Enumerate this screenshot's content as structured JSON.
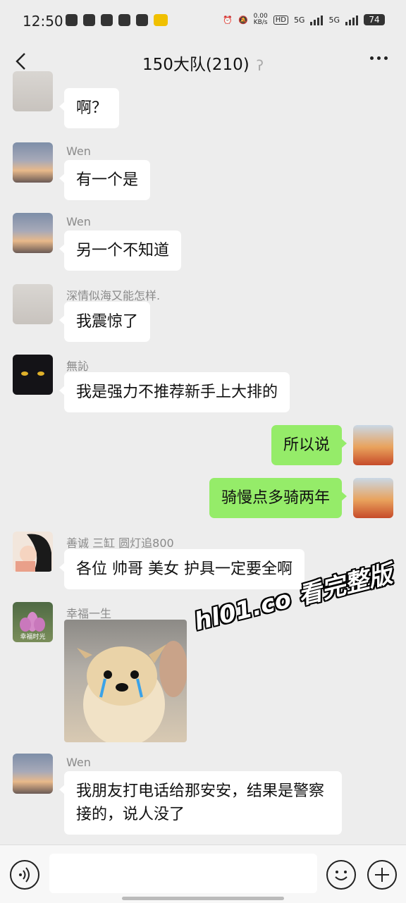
{
  "status_bar": {
    "time": "12:50",
    "net_speed_value": "0.00",
    "net_speed_unit": "KB/s",
    "hd_label": "HD",
    "signal1_label": "5G",
    "signal2_label": "5G",
    "battery": "74"
  },
  "header": {
    "title": "150大队(210)"
  },
  "messages": [
    {
      "sender": "",
      "text": "啊？"
    },
    {
      "sender": "Wen",
      "text": "有一个是"
    },
    {
      "sender": "Wen",
      "text": "另一个不知道"
    },
    {
      "sender": "深情似海又能怎样.",
      "text": "我震惊了"
    },
    {
      "sender": "無訫",
      "text": "我是强力不推荐新手上大排的"
    },
    {
      "sender": "me",
      "text": "所以说"
    },
    {
      "sender": "me",
      "text": "骑慢点多骑两年"
    },
    {
      "sender": "善诚 三缸 圆灯追800",
      "text": "各位 帅哥 美女 护具一定要全啊"
    },
    {
      "sender": "幸福一生",
      "image": "crying-puppy-sticker"
    },
    {
      "sender": "Wen",
      "text": "我朋友打电话给那安安，结果是警察接的，说人没了"
    }
  ],
  "avatar_captions": {
    "lotus": "幸福时光"
  },
  "watermark": "hl01.co 看完整版",
  "colors": {
    "background": "#ededed",
    "bubble_other": "#ffffff",
    "bubble_mine": "#95ec69"
  }
}
